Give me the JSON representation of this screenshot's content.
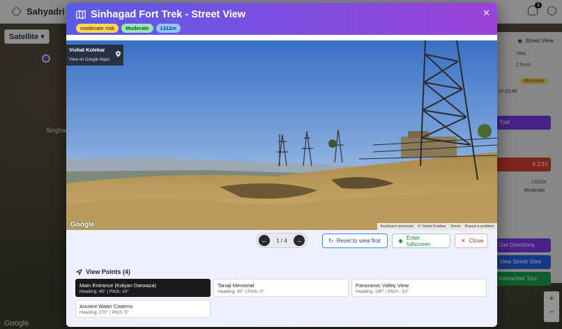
{
  "background": {
    "brand": "Sahyadri Gu",
    "notification_count": "2",
    "map_type": "Satellite",
    "map_label": "Singhad",
    "google": "Google",
    "street_view_button": "Street View",
    "stat1": "78%",
    "stat2": "2.5mm",
    "time": "15:23:48",
    "moderate_pill": "Moderate",
    "trail_label": "Trail",
    "risk_score": "6.2/10",
    "elevation": "1312m",
    "difficulty": "Moderate",
    "directions": "Get Directions",
    "view_street_view": "View Street View",
    "tour": "Interactive Tour"
  },
  "modal": {
    "title": "Sinhagad Fort Trek - Street View",
    "badges": {
      "risk": "moderate risk",
      "difficulty": "Moderate",
      "elevation": "1312m"
    },
    "street_view": {
      "author": "Vishal Kolekar",
      "link": "View on Google Maps",
      "google": "Google",
      "footer": [
        "Keyboard shortcuts",
        "© Vishal Kolekar",
        "Terms",
        "Report a problem"
      ]
    },
    "pager": {
      "text": "1 / 4"
    },
    "actions": {
      "reset": "Reset to view first",
      "fullscreen": "Enter fullscreen",
      "close": "Close"
    },
    "viewpoints_title": "View Points (4)",
    "viewpoints": [
      {
        "name": "Main Entrance (Kalyan Darwaza)",
        "meta": "Heading: 45° | Pitch: 10°"
      },
      {
        "name": "Tanaji Memorial",
        "meta": "Heading: 90° | Pitch: 0°"
      },
      {
        "name": "Panoramic Valley View",
        "meta": "Heading: 180° | Pitch: -10°"
      },
      {
        "name": "Ancient Water Cisterns",
        "meta": "Heading: 270° | Pitch: 5°"
      }
    ]
  },
  "colors": {
    "accent": "#7c4fe0",
    "primary_blue": "#3b82f6",
    "success": "#15803d",
    "danger": "#c02626"
  }
}
